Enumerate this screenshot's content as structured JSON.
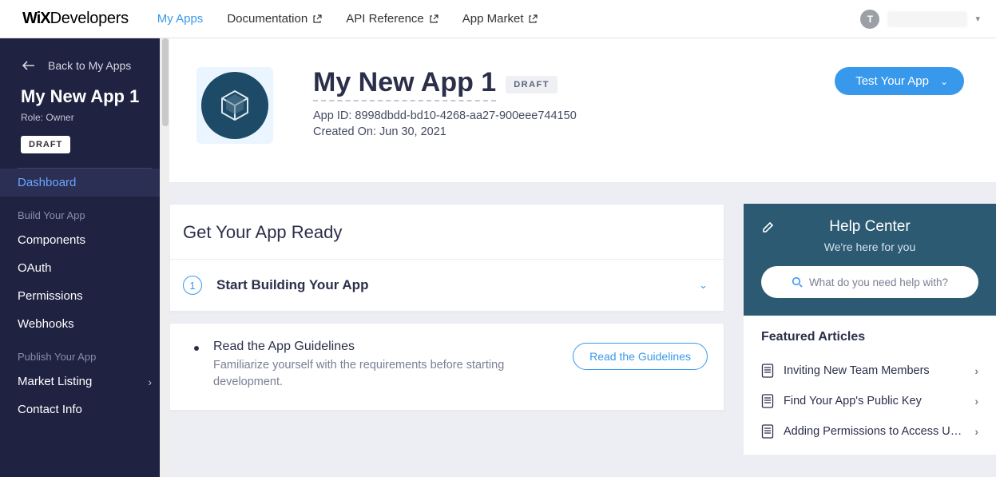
{
  "brand": {
    "bold": "WiX",
    "rest": "Developers"
  },
  "topnav": {
    "links": [
      {
        "label": "My Apps",
        "external": false,
        "active": true
      },
      {
        "label": "Documentation",
        "external": true,
        "active": false
      },
      {
        "label": "API Reference",
        "external": true,
        "active": false
      },
      {
        "label": "App Market",
        "external": true,
        "active": false
      }
    ],
    "avatar_initial": "T"
  },
  "sidebar": {
    "back_label": "Back to My Apps",
    "app_name": "My New App 1",
    "role_line": "Role: Owner",
    "badge": "DRAFT",
    "selected": "Dashboard",
    "section_build": "Build Your App",
    "items_build": [
      "Components",
      "OAuth",
      "Permissions",
      "Webhooks"
    ],
    "section_publish": "Publish Your App",
    "items_publish": [
      {
        "label": "Market Listing",
        "has_chevron": true
      },
      {
        "label": "Contact Info",
        "has_chevron": false
      }
    ]
  },
  "app": {
    "title": "My New App 1",
    "badge": "DRAFT",
    "id_line": "App ID: 8998dbdd-bd10-4268-aa27-900eee744150",
    "created_line": "Created On: Jun 30, 2021",
    "test_button": "Test Your App"
  },
  "ready": {
    "heading": "Get Your App Ready",
    "step_number": "1",
    "step_title": "Start Building Your App"
  },
  "guidelines": {
    "title": "Read the App Guidelines",
    "desc": "Familiarize yourself with the requirements before starting development.",
    "button": "Read the Guidelines"
  },
  "help": {
    "title": "Help Center",
    "subtitle": "We're here for you",
    "search_placeholder": "What do you need help with?",
    "featured_heading": "Featured Articles",
    "articles": [
      "Inviting New Team Members",
      "Find Your App's Public Key",
      "Adding Permissions to Access User ..."
    ]
  }
}
